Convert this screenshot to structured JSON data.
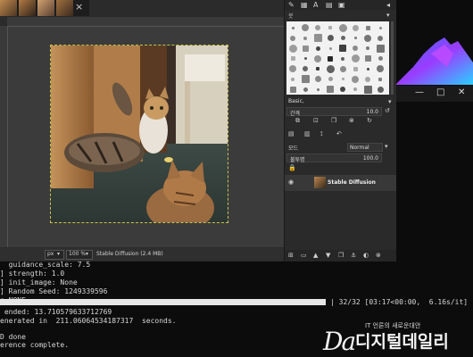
{
  "gimp": {
    "tab_close_symbol": "×",
    "statusbar": {
      "unit": "px",
      "unit_caret": "▾",
      "zoom": "100 %",
      "zoom_caret": "▾",
      "info": "Stable Diffusion (2.4 MB)"
    }
  },
  "dock": {
    "brush_panel_title": "붓",
    "brush_name": "Basic,",
    "spacing_label": "간격",
    "spacing_value": "10.0",
    "mode_label": "모드",
    "mode_value": "Normal",
    "opacity_label": "불투명",
    "opacity_value": "100.0",
    "layer_name": "Stable Diffusion",
    "colors": {
      "panel": "#2a2a2a",
      "layer_selected": "#383838",
      "text": "#dddddd"
    }
  },
  "terminal": {
    "lines": [
      "  guidance_scale: 7.5",
      "] strength: 1.0",
      "] init_image: None",
      "] Random Seed: 1249339596",
      "s NONE",
      "",
      " ended: 13.710579633712769",
      "enerated in  211.06064534187317  seconds.",
      "",
      "D done",
      "erence complete."
    ],
    "progress": {
      "fraction": 1.0,
      "text": "| 32/32 [03:17<00:00,  6.16s/it]"
    }
  },
  "window_controls": {
    "minimize": "—",
    "maximize": "□",
    "close": "✕"
  },
  "watermark": {
    "tagline": "IT 언론의 새로운대안",
    "logo_mark": "Da",
    "name": "디지털데일리"
  }
}
